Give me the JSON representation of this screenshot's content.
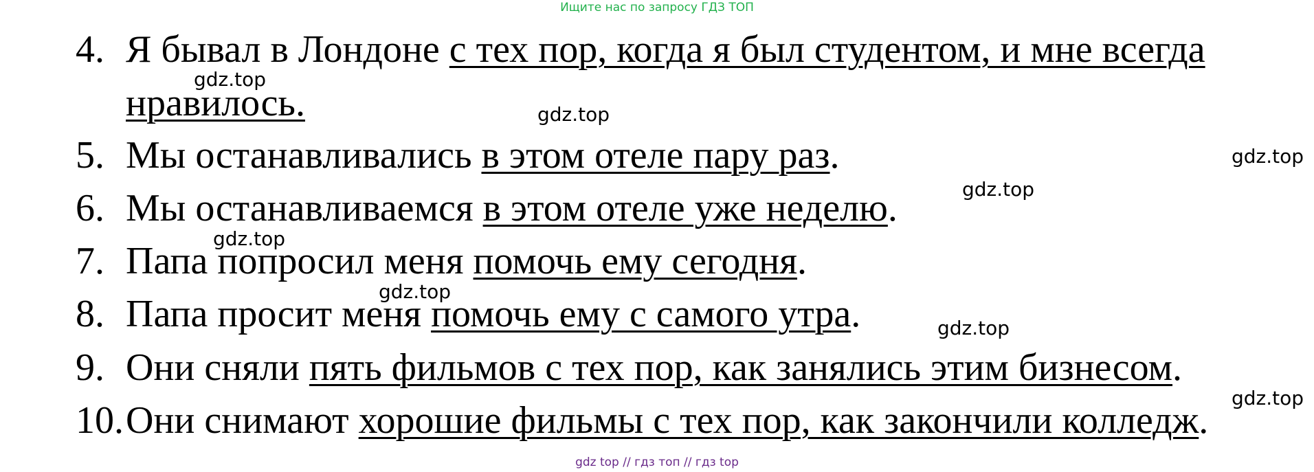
{
  "banner": {
    "text": "Ищите нас по запросу ГДЗ ТОП",
    "color": "#22b14c"
  },
  "items": [
    {
      "number": "4.",
      "plain": "Я бывал в Лондоне ",
      "underlined_1": "с тех пор, когда я был студентом, и мне всегда",
      "underlined_2": "нравилось.",
      "end": ""
    },
    {
      "number": "5.",
      "plain": "Мы останавливались ",
      "underlined": "в этом отеле пару раз",
      "end": "."
    },
    {
      "number": "6.",
      "plain": "Мы останавливаемся ",
      "underlined": "в этом отеле уже неделю",
      "end": "."
    },
    {
      "number": "7.",
      "plain": "Папа попросил меня ",
      "underlined": "помочь ему сегодня",
      "end": "."
    },
    {
      "number": "8.",
      "plain": "Папа просит меня ",
      "underlined": "помочь ему с самого утра",
      "end": "."
    },
    {
      "number": "9.",
      "plain": "Они сняли ",
      "underlined": "пять фильмов с тех пор, как занялись этим бизнесом",
      "end": "."
    },
    {
      "number": "10.",
      "plain": "Они снимают ",
      "underlined": "хорошие фильмы с тех пор, как закончили колледж",
      "end": "."
    }
  ],
  "watermarks": [
    "gdz.top",
    "gdz.top",
    "gdz.top",
    "gdz.top",
    "gdz.top",
    "gdz.top",
    "gdz.top",
    "gdz.top"
  ],
  "footer": {
    "text": "gdz top  //  гдз топ  //  гдз top",
    "color": "#6a2b8a"
  }
}
